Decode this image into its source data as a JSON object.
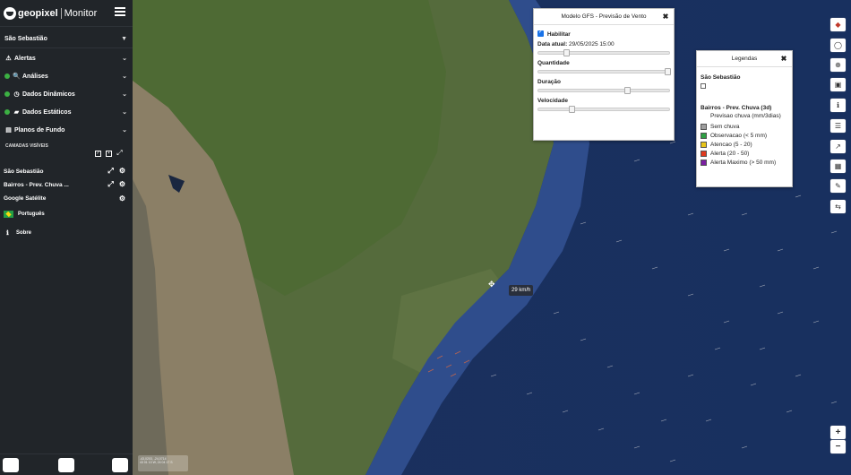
{
  "brand": {
    "name": "geopixel",
    "app": "Monitor"
  },
  "sidebar": {
    "location": "São Sebastião",
    "sections": [
      {
        "label": "Alertas",
        "icon": "warning-icon"
      },
      {
        "label": "Análises",
        "icon": "search-icon"
      },
      {
        "label": "Dados Dinâmicos",
        "icon": "clock-icon"
      },
      {
        "label": "Dados Estáticos",
        "icon": "folder-icon"
      },
      {
        "label": "Planos de Fundo",
        "icon": "map-icon"
      }
    ],
    "visible_layers_title": "CAMADAS VISÍVEIS",
    "layers": [
      {
        "label": "São Sebastião"
      },
      {
        "label": "Bairros - Prev. Chuva ..."
      },
      {
        "label": "Google Satélite"
      }
    ],
    "language": "Português",
    "about": "Sobre"
  },
  "gfs_panel": {
    "title": "Modelo GFS - Previsão de Vento",
    "enable_label": "Habilitar",
    "date_label": "Data atual:",
    "date_value": "29/05/2025 15:00",
    "quantity_label": "Quantidade",
    "duration_label": "Duração",
    "speed_label": "Velocidade",
    "sliders": {
      "date": 0.2,
      "quantity": 1.0,
      "duration": 0.68,
      "speed": 0.24
    }
  },
  "legend_panel": {
    "title": "Legendas",
    "group1": "São Sebastião",
    "group2": "Bairros - Prev. Chuva (3d)",
    "subtitle": "Previsao chuva (mm/3dias)",
    "items": [
      {
        "label": "Sem chuva",
        "color": "#9e9e9e"
      },
      {
        "label": "Observacao (< 5 mm)",
        "color": "#2ea043"
      },
      {
        "label": "Atencao (5 - 20)",
        "color": "#e8c51a"
      },
      {
        "label": "Alerta (20 - 50)",
        "color": "#e03a1f"
      },
      {
        "label": "Alerta Maximo (> 50 mm)",
        "color": "#7b1fa2"
      }
    ]
  },
  "map": {
    "wind_tooltip": "29 km/h",
    "coord_line1": "-43,0203, -24,0714",
    "coord_line2": "43 01 13 W, 24 04 17 S"
  },
  "toolbar": [
    "shapes-icon",
    "select-icon",
    "zoom-icon",
    "image-icon",
    "info-icon",
    "list-icon",
    "chart-icon",
    "table-icon",
    "measure-icon",
    "route-icon"
  ],
  "zoom": {
    "in": "+",
    "out": "−"
  }
}
